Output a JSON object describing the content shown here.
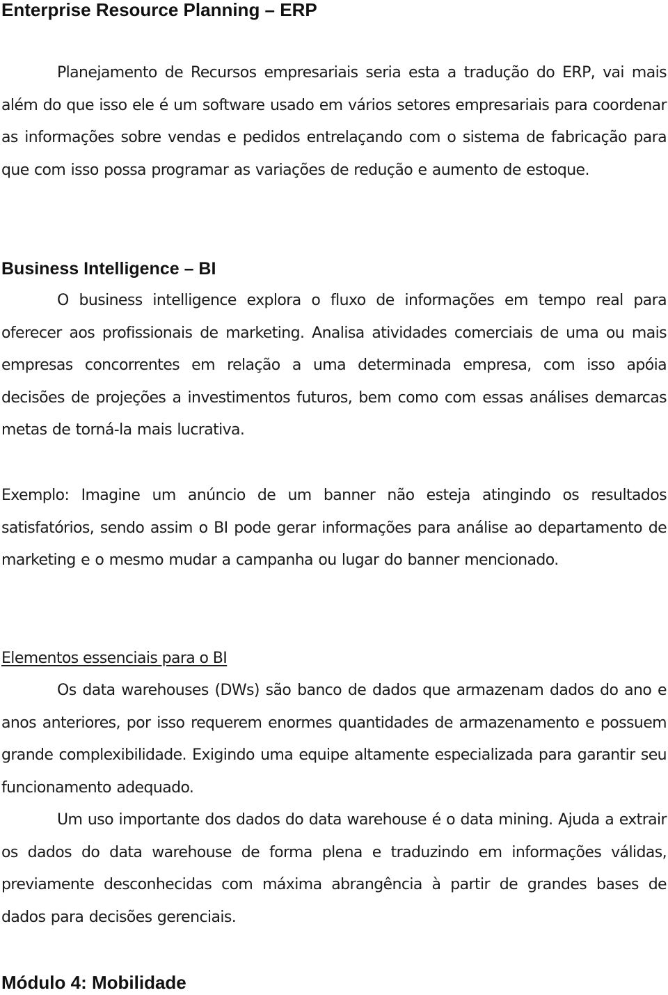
{
  "document": {
    "erp_heading": "Enterprise Resource Planning – ERP",
    "erp_paragraph": "Planejamento de Recursos empresariais seria esta a tradução do ERP, vai mais além do que isso ele é um software usado em vários setores empresariais para coordenar as informações sobre vendas e pedidos entrelaçando com o sistema de fabricação para que com isso possa programar as variações de redução e aumento de estoque.",
    "bi_heading": "Business Intelligence – BI",
    "bi_paragraph": "O business intelligence explora o fluxo de informações em tempo real para oferecer aos profissionais de marketing. Analisa atividades comerciais de uma ou mais empresas concorrentes em relação a uma determinada empresa, com isso apóia decisões de projeções a investimentos futuros, bem como com essas análises demarcas metas de torná-la mais lucrativa.",
    "example_paragraph": "Exemplo: Imagine um anúncio de um banner não esteja atingindo os resultados satisfatórios, sendo assim o BI pode gerar informações para análise ao departamento de marketing e o mesmo mudar a campanha ou lugar do banner mencionado.",
    "elements_heading": "Elementos essenciais para o BI",
    "dw_paragraph": "Os data warehouses (DWs) são banco de dados que armazenam dados do ano e anos anteriores, por isso requerem enormes quantidades de armazenamento e possuem grande complexibilidade. Exigindo uma equipe altamente especializada para garantir seu funcionamento adequado.",
    "mining_paragraph": "Um uso importante dos dados do data warehouse é o data mining. Ajuda a extrair os dados do data warehouse de forma plena e traduzindo em informações válidas, previamente desconhecidas com máxima abrangência à partir de grandes bases de dados para decisões gerenciais.",
    "module_heading": "Módulo 4: Mobilidade"
  }
}
